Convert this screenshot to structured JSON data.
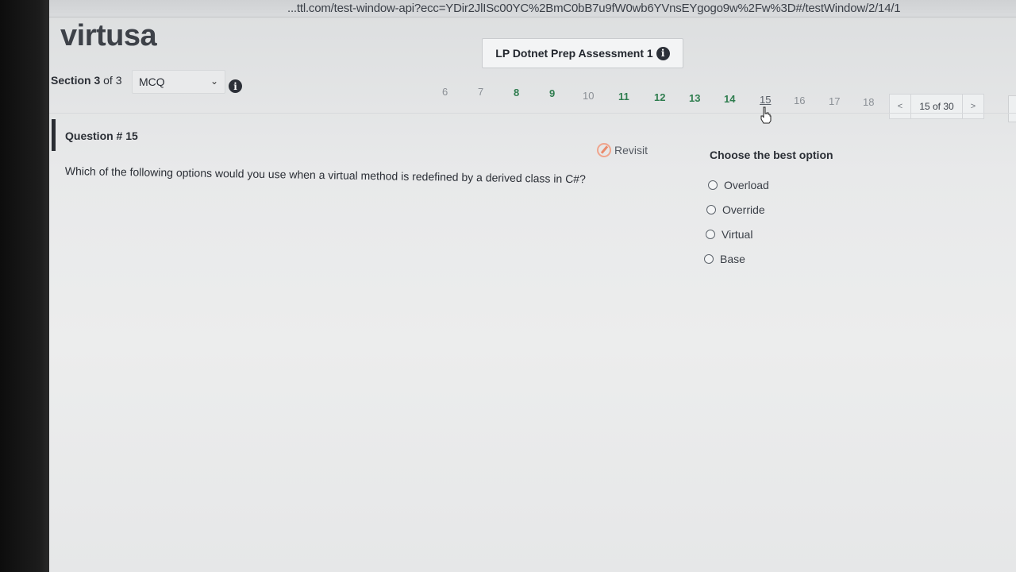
{
  "browser": {
    "url": "...ttl.com/test-window-api?ecc=YDir2JlISc00YC%2BmC0bB7u9fW0wb6YVnsEYgogo9w%2Fw%3D#/testWindow/2/14/1"
  },
  "header": {
    "logo": "virtusa",
    "assessment_title": "LP Dotnet Prep Assessment 1",
    "info_icon": "info-icon"
  },
  "section": {
    "label_bold": "Section 3",
    "label_rest": " of 3",
    "selected_type": "MCQ"
  },
  "question_nav": {
    "numbers": [
      {
        "n": "6",
        "status": "unvisited"
      },
      {
        "n": "7",
        "status": "unvisited"
      },
      {
        "n": "8",
        "status": "answered"
      },
      {
        "n": "9",
        "status": "answered"
      },
      {
        "n": "10",
        "status": "unvisited"
      },
      {
        "n": "11",
        "status": "answered"
      },
      {
        "n": "12",
        "status": "answered"
      },
      {
        "n": "13",
        "status": "answered"
      },
      {
        "n": "14",
        "status": "answered"
      },
      {
        "n": "15",
        "status": "current"
      },
      {
        "n": "16",
        "status": "unvisited"
      },
      {
        "n": "17",
        "status": "unvisited"
      },
      {
        "n": "18",
        "status": "unvisited"
      }
    ],
    "prev_label": "<",
    "next_label": ">",
    "position": "15 of 30"
  },
  "question": {
    "title": "Question # 15",
    "revisit_label": "Revisit",
    "text": "Which of the following options would you use when a virtual method is redefined by a derived class in C#?"
  },
  "answers": {
    "heading": "Choose the best option",
    "options": [
      "Overload",
      "Override",
      "Virtual",
      "Base"
    ]
  },
  "colors": {
    "answered": "#2f7d4f",
    "unvisited": "#8b9096",
    "revisit_accent": "#e98a6b"
  }
}
